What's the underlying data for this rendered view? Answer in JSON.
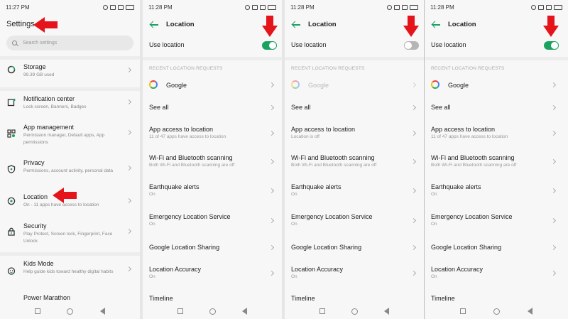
{
  "settings_panel": {
    "time": "11:27 PM",
    "title": "Settings",
    "search_placeholder": "Search settings",
    "items": [
      {
        "label": "Storage",
        "sub": "99.39 GB used"
      },
      {
        "label": "Notification center",
        "sub": "Lock screen, Banners, Badges"
      },
      {
        "label": "App management",
        "sub": "Permission manager, Default apps, App permissions"
      },
      {
        "label": "Privacy",
        "sub": "Permissions, account activity, personal data"
      },
      {
        "label": "Location",
        "sub": "On - 11 apps have access to location"
      },
      {
        "label": "Security",
        "sub": "Play Protect, Screen lock, Fingerprint, Face Unlock"
      },
      {
        "label": "Kids Mode",
        "sub": "Help guide kids toward healthy digital habits"
      },
      {
        "label": "Power Marathon",
        "sub": ""
      }
    ]
  },
  "location_panels": [
    {
      "time": "11:28 PM",
      "title": "Location",
      "use_location": "Use location",
      "toggle_on": true,
      "recent_header": "RECENT LOCATION REQUESTS",
      "google": "Google",
      "see_all": "See all",
      "rows": [
        {
          "label": "App access to location",
          "sub": "11 of 47 apps have access to location"
        },
        {
          "label": "Wi-Fi and Bluetooth scanning",
          "sub": "Both Wi-Fi and Bluetooth scanning are off"
        },
        {
          "label": "Earthquake alerts",
          "sub": "On"
        },
        {
          "label": "Emergency Location Service",
          "sub": "On"
        },
        {
          "label": "Google Location Sharing",
          "sub": ""
        },
        {
          "label": "Location Accuracy",
          "sub": "On"
        },
        {
          "label": "Timeline",
          "sub": ""
        }
      ]
    },
    {
      "time": "11:28 PM",
      "title": "Location",
      "use_location": "Use location",
      "toggle_on": false,
      "recent_header": "RECENT LOCATION REQUESTS",
      "google": "Google",
      "see_all": "See all",
      "rows": [
        {
          "label": "App access to location",
          "sub": "Location is off"
        },
        {
          "label": "Wi-Fi and Bluetooth scanning",
          "sub": "Both Wi-Fi and Bluetooth scanning are off"
        },
        {
          "label": "Earthquake alerts",
          "sub": "On"
        },
        {
          "label": "Emergency Location Service",
          "sub": "On"
        },
        {
          "label": "Google Location Sharing",
          "sub": ""
        },
        {
          "label": "Location Accuracy",
          "sub": "On"
        },
        {
          "label": "Timeline",
          "sub": ""
        }
      ]
    },
    {
      "time": "11:28 PM",
      "title": "Location",
      "use_location": "Use location",
      "toggle_on": true,
      "recent_header": "RECENT LOCATION REQUESTS",
      "google": "Google",
      "see_all": "See all",
      "rows": [
        {
          "label": "App access to location",
          "sub": "11 of 47 apps have access to location"
        },
        {
          "label": "Wi-Fi and Bluetooth scanning",
          "sub": "Both Wi-Fi and Bluetooth scanning are off"
        },
        {
          "label": "Earthquake alerts",
          "sub": "On"
        },
        {
          "label": "Emergency Location Service",
          "sub": "On"
        },
        {
          "label": "Google Location Sharing",
          "sub": ""
        },
        {
          "label": "Location Accuracy",
          "sub": "On"
        },
        {
          "label": "Timeline",
          "sub": ""
        }
      ]
    }
  ],
  "colors": {
    "accent": "#1aa260",
    "annotation_arrow": "#e5141b",
    "toggle_off": "#b5b5b5"
  },
  "icons": [
    "storage-icon",
    "notification-icon",
    "apps-icon",
    "privacy-shield-icon",
    "location-pin-icon",
    "security-lock-icon",
    "kids-icon",
    "back-arrow-icon",
    "google-icon",
    "chevron-right-icon"
  ]
}
